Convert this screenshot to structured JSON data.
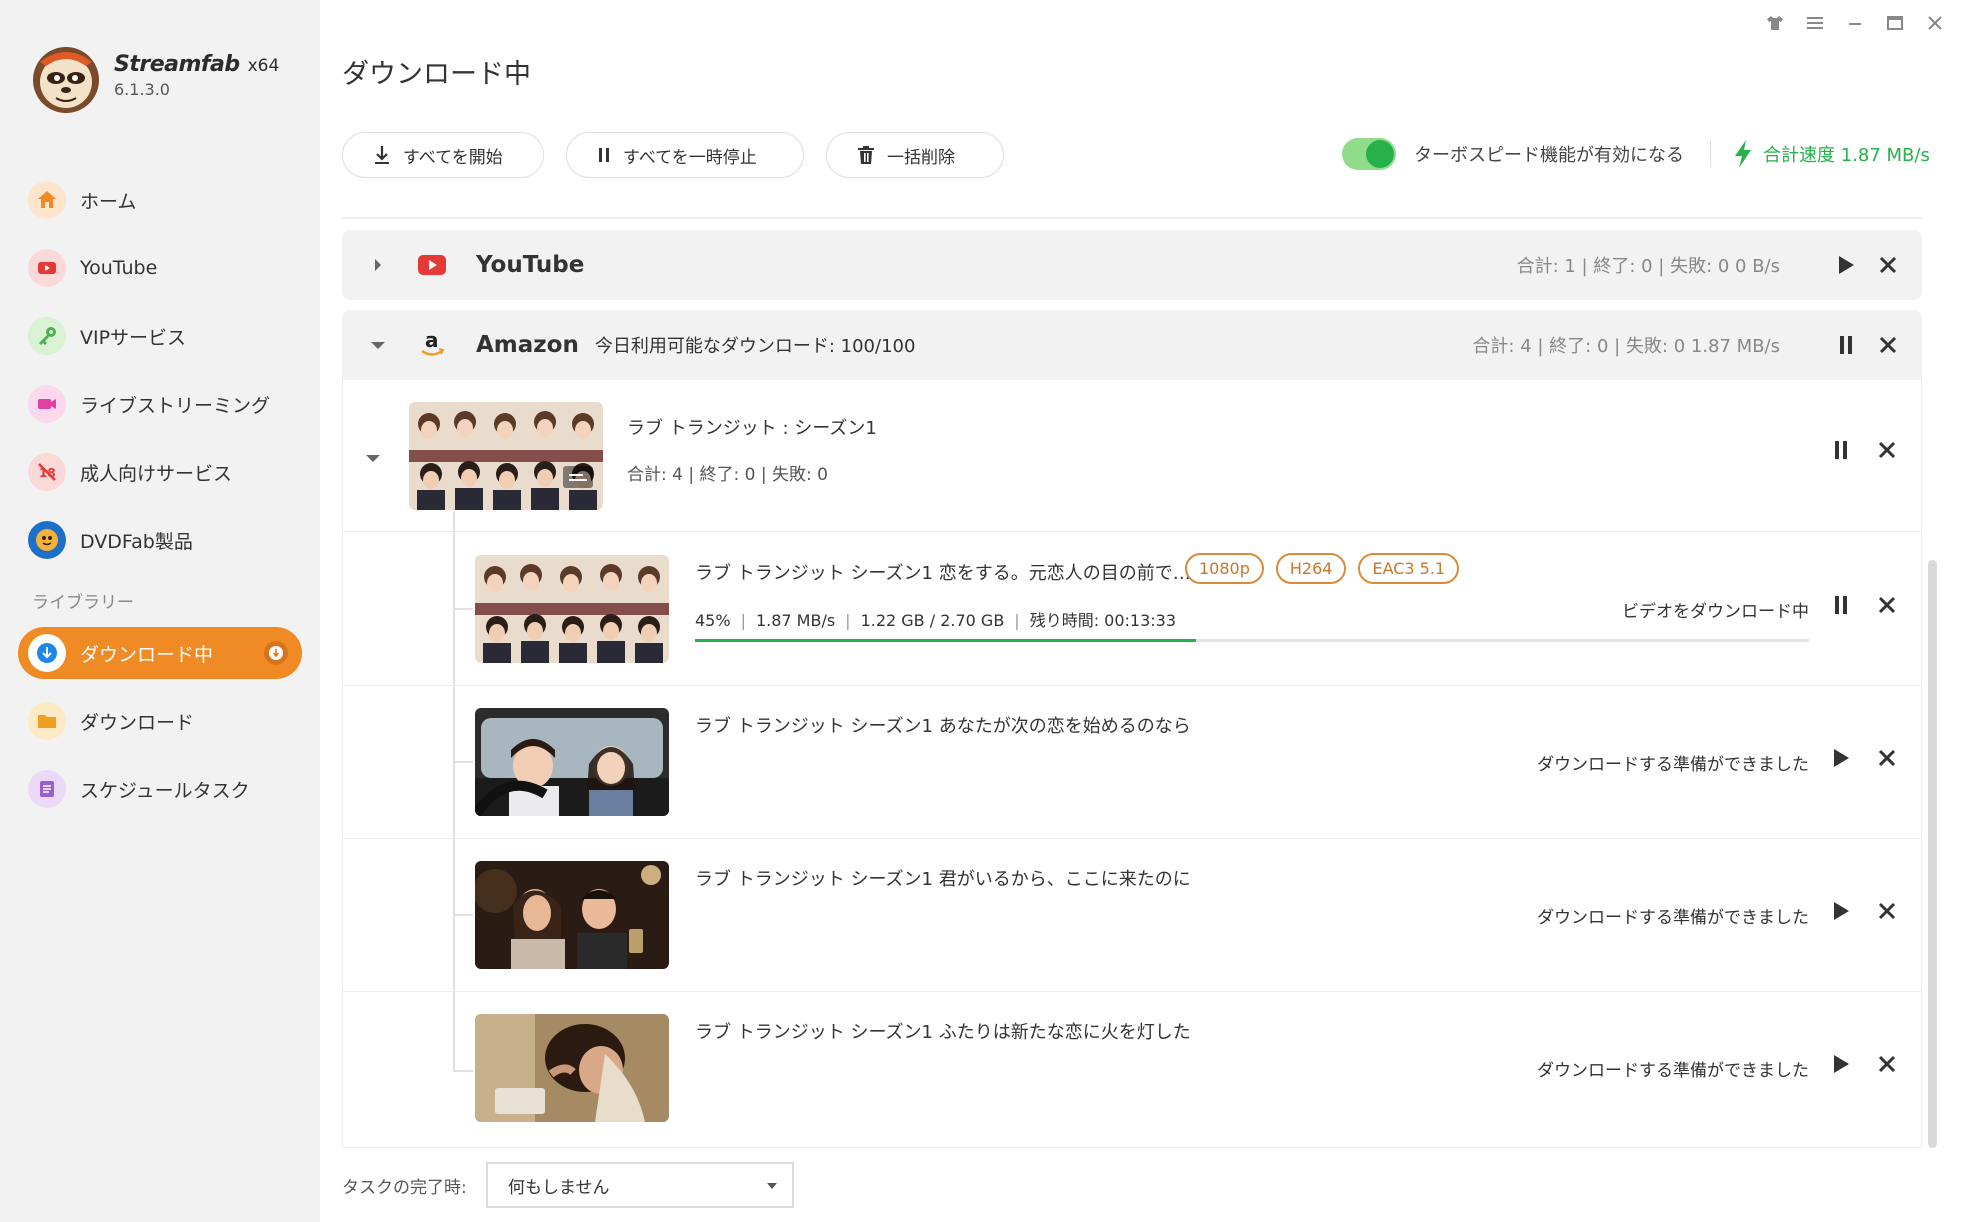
{
  "app": {
    "name": "Streamfab",
    "arch": "x64",
    "version": "6.1.3.0"
  },
  "sidebar": {
    "items": [
      {
        "label": "ホーム",
        "icon": "home-icon",
        "color": "#f08a24"
      },
      {
        "label": "YouTube",
        "icon": "youtube-icon",
        "color": "#e53935"
      },
      {
        "label": "VIPサービス",
        "icon": "key-icon",
        "color": "#4caf50"
      },
      {
        "label": "ライブストリーミング",
        "icon": "camera-icon",
        "color": "#e040a0"
      },
      {
        "label": "成人向けサービス",
        "icon": "adult-icon",
        "color": "#e53935"
      },
      {
        "label": "DVDFab製品",
        "icon": "dvdfab-icon",
        "color": "#1e88e5"
      }
    ],
    "library_label": "ライブラリー",
    "library": [
      {
        "label": "ダウンロード中",
        "icon": "download-icon",
        "active": true
      },
      {
        "label": "ダウンロード",
        "icon": "folder-icon",
        "color": "#f0a020"
      },
      {
        "label": "スケジュールタスク",
        "icon": "schedule-icon",
        "color": "#9c5fd0"
      }
    ]
  },
  "page": {
    "title": "ダウンロード中"
  },
  "toolbar": {
    "start_all": "すべてを開始",
    "pause_all": "すべてを一時停止",
    "delete_all": "一括削除",
    "turbo_label": "ターボスピード機能が有効になる",
    "speed_label": "合計速度 1.87 MB/s"
  },
  "groups": {
    "youtube": {
      "name": "YouTube",
      "stats": "合計: 1 | 終了: 0 | 失敗: 0    0 B/s"
    },
    "amazon": {
      "name": "Amazon",
      "quota": "今日利用可能なダウンロード: 100/100",
      "stats": "合計: 4 | 終了: 0 | 失敗: 0    1.87 MB/s"
    }
  },
  "season": {
    "title": "ラブ トランジット : シーズン1",
    "stats": "合計: 4  |  終了: 0  |  失敗: 0"
  },
  "episodes": [
    {
      "title": "ラブ トランジット シーズン1 恋をする。元恋人の目の前で…",
      "tags": [
        "1080p",
        "H264",
        "EAC3 5.1"
      ],
      "percent": "45%",
      "progress": 0.45,
      "speed": "1.87 MB/s",
      "size": "1.22 GB / 2.70 GB",
      "remaining": "残り時間: 00:13:33",
      "status": "ビデオをダウンロード中"
    },
    {
      "title": "ラブ トランジット シーズン1 あなたが次の恋を始めるのなら",
      "status": "ダウンロードする準備ができました"
    },
    {
      "title": "ラブ トランジット シーズン1 君がいるから、ここに来たのに",
      "status": "ダウンロードする準備ができました"
    },
    {
      "title": "ラブ トランジット シーズン1 ふたりは新たな恋に火を灯した",
      "status": "ダウンロードする準備ができました"
    }
  ],
  "footer": {
    "completion_label": "タスクの完了時:",
    "completion_value": "何もしません"
  },
  "colors": {
    "accent": "#f08a24",
    "green": "#27b14a",
    "tag": "#c8762a"
  }
}
